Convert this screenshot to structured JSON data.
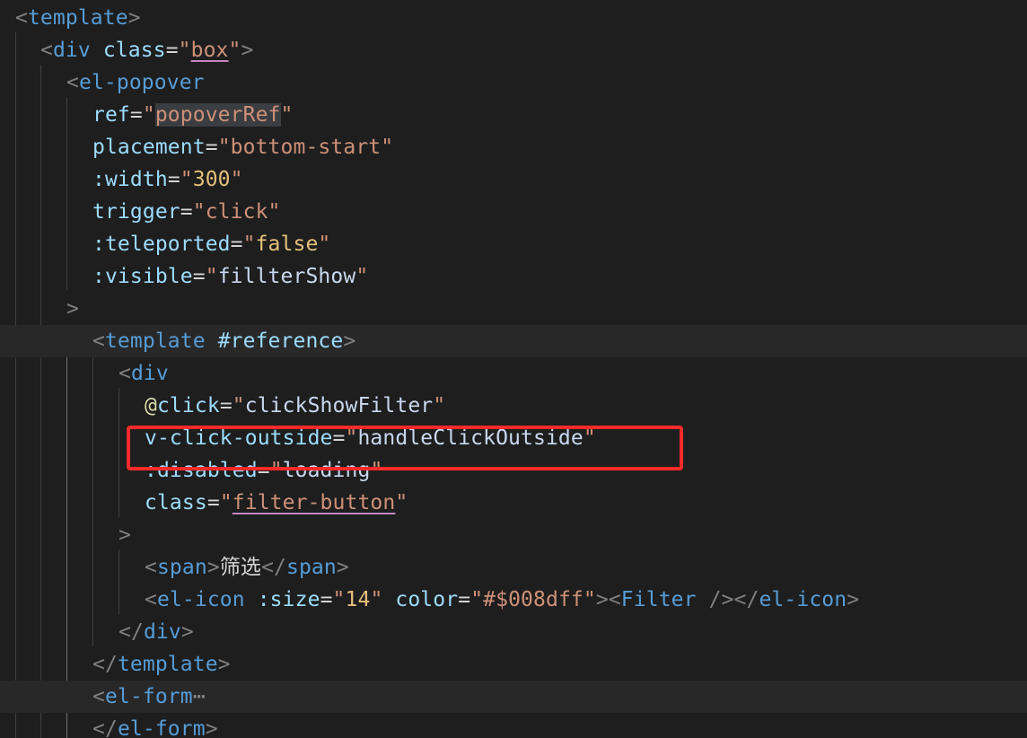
{
  "editor": {
    "lines": [
      {
        "tokens": [
          {
            "text": "<",
            "cls": "t-punc"
          },
          {
            "text": "template",
            "cls": "t-tag"
          },
          {
            "text": ">",
            "cls": "t-punc"
          }
        ]
      },
      {
        "tokens": [
          {
            "text": "<",
            "cls": "t-punc"
          },
          {
            "text": "div",
            "cls": "t-tag"
          },
          {
            "text": " ",
            "cls": "t-text"
          },
          {
            "text": "class",
            "cls": "t-attr"
          },
          {
            "text": "=",
            "cls": "t-eq"
          },
          {
            "text": "\"",
            "cls": "t-str"
          },
          {
            "text": "box",
            "cls": "t-str u-pink"
          },
          {
            "text": "\"",
            "cls": "t-str"
          },
          {
            "text": ">",
            "cls": "t-punc"
          }
        ]
      },
      {
        "tokens": [
          {
            "text": "<",
            "cls": "t-punc"
          },
          {
            "text": "el-popover",
            "cls": "t-tag"
          }
        ]
      },
      {
        "tokens": [
          {
            "text": "ref",
            "cls": "t-attr"
          },
          {
            "text": "=",
            "cls": "t-eq"
          },
          {
            "text": "\"",
            "cls": "t-str"
          },
          {
            "text": "popoverRef",
            "cls": "t-str hl-word"
          },
          {
            "text": "\"",
            "cls": "t-str"
          }
        ]
      },
      {
        "tokens": [
          {
            "text": "placement",
            "cls": "t-attr"
          },
          {
            "text": "=",
            "cls": "t-eq"
          },
          {
            "text": "\"bottom-start\"",
            "cls": "t-str"
          }
        ]
      },
      {
        "tokens": [
          {
            "text": ":width",
            "cls": "t-attr"
          },
          {
            "text": "=",
            "cls": "t-eq"
          },
          {
            "text": "\"",
            "cls": "t-str"
          },
          {
            "text": "300",
            "cls": "t-num"
          },
          {
            "text": "\"",
            "cls": "t-str"
          }
        ]
      },
      {
        "tokens": [
          {
            "text": "trigger",
            "cls": "t-attr"
          },
          {
            "text": "=",
            "cls": "t-eq"
          },
          {
            "text": "\"click\"",
            "cls": "t-str"
          }
        ]
      },
      {
        "tokens": [
          {
            "text": ":teleported",
            "cls": "t-attr"
          },
          {
            "text": "=",
            "cls": "t-eq"
          },
          {
            "text": "\"",
            "cls": "t-str"
          },
          {
            "text": "false",
            "cls": "t-num"
          },
          {
            "text": "\"",
            "cls": "t-str"
          }
        ]
      },
      {
        "tokens": [
          {
            "text": ":visible",
            "cls": "t-attr"
          },
          {
            "text": "=",
            "cls": "t-eq"
          },
          {
            "text": "\"",
            "cls": "t-str"
          },
          {
            "text": "fillterShow",
            "cls": "t-strv"
          },
          {
            "text": "\"",
            "cls": "t-str"
          }
        ]
      },
      {
        "tokens": [
          {
            "text": ">",
            "cls": "t-punc"
          }
        ]
      },
      {
        "tokens": [
          {
            "text": "<",
            "cls": "t-punc"
          },
          {
            "text": "template",
            "cls": "t-tag"
          },
          {
            "text": " ",
            "cls": "t-text"
          },
          {
            "text": "#reference",
            "cls": "t-attr"
          },
          {
            "text": ">",
            "cls": "t-punc"
          }
        ]
      },
      {
        "tokens": [
          {
            "text": "<",
            "cls": "t-punc"
          },
          {
            "text": "div",
            "cls": "t-tag"
          }
        ]
      },
      {
        "tokens": [
          {
            "text": "@",
            "cls": "t-at"
          },
          {
            "text": "click",
            "cls": "t-attr"
          },
          {
            "text": "=",
            "cls": "t-eq"
          },
          {
            "text": "\"",
            "cls": "t-str"
          },
          {
            "text": "clickShowFilter",
            "cls": "t-strv"
          },
          {
            "text": "\"",
            "cls": "t-str"
          }
        ]
      },
      {
        "tokens": [
          {
            "text": "v-click-outside",
            "cls": "t-attr"
          },
          {
            "text": "=",
            "cls": "t-eq"
          },
          {
            "text": "\"",
            "cls": "t-str"
          },
          {
            "text": "handleClickOutside",
            "cls": "t-strv"
          },
          {
            "text": "\"",
            "cls": "t-str"
          }
        ]
      },
      {
        "tokens": [
          {
            "text": ":disabled",
            "cls": "t-attr"
          },
          {
            "text": "=",
            "cls": "t-eq"
          },
          {
            "text": "\"",
            "cls": "t-str"
          },
          {
            "text": "loading",
            "cls": "t-strv"
          },
          {
            "text": "\"",
            "cls": "t-str"
          }
        ]
      },
      {
        "tokens": [
          {
            "text": "class",
            "cls": "t-attr"
          },
          {
            "text": "=",
            "cls": "t-eq"
          },
          {
            "text": "\"",
            "cls": "t-str"
          },
          {
            "text": "filter-button",
            "cls": "t-str u-pink"
          },
          {
            "text": "\"",
            "cls": "t-str"
          }
        ]
      },
      {
        "tokens": [
          {
            "text": ">",
            "cls": "t-punc"
          }
        ]
      },
      {
        "tokens": [
          {
            "text": "<",
            "cls": "t-punc"
          },
          {
            "text": "span",
            "cls": "t-tag"
          },
          {
            "text": ">",
            "cls": "t-punc"
          },
          {
            "text": "筛选",
            "cls": "t-text"
          },
          {
            "text": "</",
            "cls": "t-punc"
          },
          {
            "text": "span",
            "cls": "t-tag"
          },
          {
            "text": ">",
            "cls": "t-punc"
          }
        ]
      },
      {
        "tokens": [
          {
            "text": "<",
            "cls": "t-punc"
          },
          {
            "text": "el-icon",
            "cls": "t-tag"
          },
          {
            "text": " ",
            "cls": "t-text"
          },
          {
            "text": ":size",
            "cls": "t-attr"
          },
          {
            "text": "=",
            "cls": "t-eq"
          },
          {
            "text": "\"",
            "cls": "t-str"
          },
          {
            "text": "14",
            "cls": "t-num"
          },
          {
            "text": "\"",
            "cls": "t-str"
          },
          {
            "text": " ",
            "cls": "t-text"
          },
          {
            "text": "color",
            "cls": "t-attr"
          },
          {
            "text": "=",
            "cls": "t-eq"
          },
          {
            "text": "\"#$008dff\"",
            "cls": "t-str"
          },
          {
            "text": "><",
            "cls": "t-punc"
          },
          {
            "text": "Filter",
            "cls": "t-tag"
          },
          {
            "text": " />",
            "cls": "t-punc"
          },
          {
            "text": "</",
            "cls": "t-punc"
          },
          {
            "text": "el-icon",
            "cls": "t-tag"
          },
          {
            "text": ">",
            "cls": "t-punc"
          }
        ]
      },
      {
        "tokens": [
          {
            "text": "</",
            "cls": "t-punc"
          },
          {
            "text": "div",
            "cls": "t-tag"
          },
          {
            "text": ">",
            "cls": "t-punc"
          }
        ]
      },
      {
        "tokens": [
          {
            "text": "</",
            "cls": "t-punc"
          },
          {
            "text": "template",
            "cls": "t-tag"
          },
          {
            "text": ">",
            "cls": "t-punc"
          }
        ]
      },
      {
        "tokens": [
          {
            "text": "<",
            "cls": "t-punc"
          },
          {
            "text": "el-form",
            "cls": "t-tag"
          },
          {
            "text": "⋯",
            "cls": "t-ellipsis"
          }
        ]
      },
      {
        "tokens": [
          {
            "text": "</",
            "cls": "t-punc"
          },
          {
            "text": "el-form",
            "cls": "t-tag"
          },
          {
            "text": ">",
            "cls": "t-punc"
          }
        ]
      }
    ]
  },
  "colors": {
    "background": "#1e1e1e",
    "current_line": "#282828",
    "annotation_box": "#ff2a2a"
  }
}
